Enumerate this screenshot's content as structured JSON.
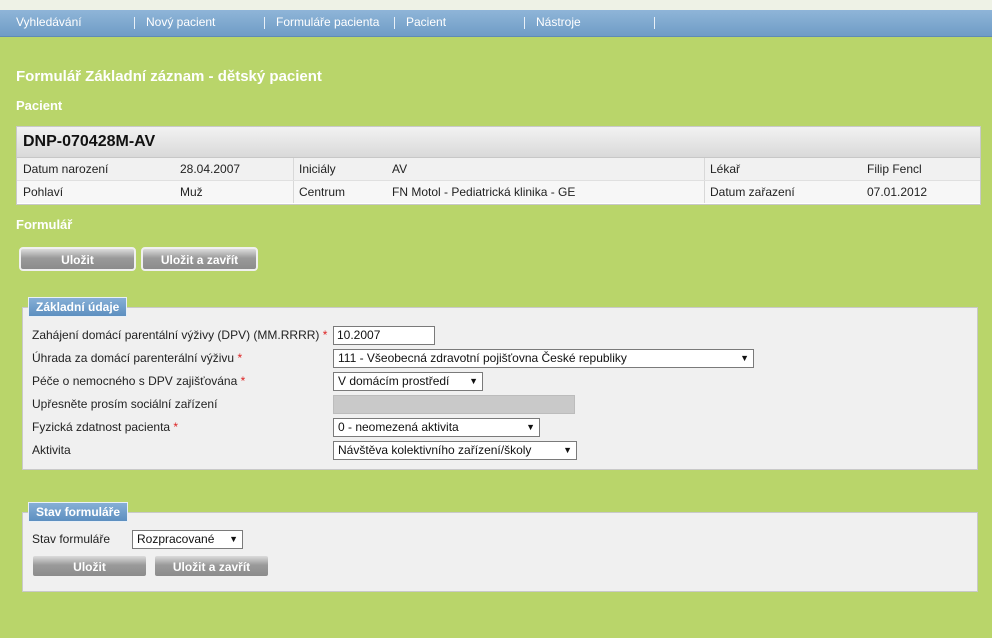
{
  "nav": {
    "items": [
      "Vyhledávání",
      "Nový pacient",
      "Formuláře pacienta",
      "Pacient",
      "Nástroje"
    ]
  },
  "page": {
    "title": "Formulář Základní záznam - dětský pacient",
    "patient_section": "Pacient",
    "form_section": "Formulář"
  },
  "patient": {
    "code": "DNP-070428M-AV",
    "birth_label": "Datum narození",
    "birth_value": "28.04.2007",
    "initials_label": "Iniciály",
    "initials_value": "AV",
    "doctor_label": "Lékař",
    "doctor_value": "Filip Fencl",
    "sex_label": "Pohlaví",
    "sex_value": "Muž",
    "center_label": "Centrum",
    "center_value": "FN Motol - Pediatrická klinika - GE",
    "enrolled_label": "Datum zařazení",
    "enrolled_value": "07.01.2012"
  },
  "buttons": {
    "save": "Uložit",
    "save_close": "Uložit a zavřít"
  },
  "basic": {
    "legend": "Základní údaje",
    "dpv_start_label": "Zahájení domácí parentální výživy (DPV) (MM.RRRR)",
    "dpv_start_value": "10.2007",
    "payment_label": "Úhrada za domácí parenterální výživu",
    "payment_value": "111 - Všeobecná zdravotní pojišťovna České republiky",
    "care_label": "Péče o nemocného s DPV zajišťována",
    "care_value": "V domácím prostředí",
    "social_label": "Upřesněte prosím sociální zařízení",
    "fitness_label": "Fyzická zdatnost pacienta",
    "fitness_value": "0 - neomezená aktivita",
    "activity_label": "Aktivita",
    "activity_value": "Návštěva kolektivního zařízení/školy",
    "required_mark": "*"
  },
  "status": {
    "legend": "Stav formuláře",
    "label": "Stav formuláře",
    "value": "Rozpracované"
  },
  "icons": {
    "dropdown": "chevron-down-icon"
  }
}
